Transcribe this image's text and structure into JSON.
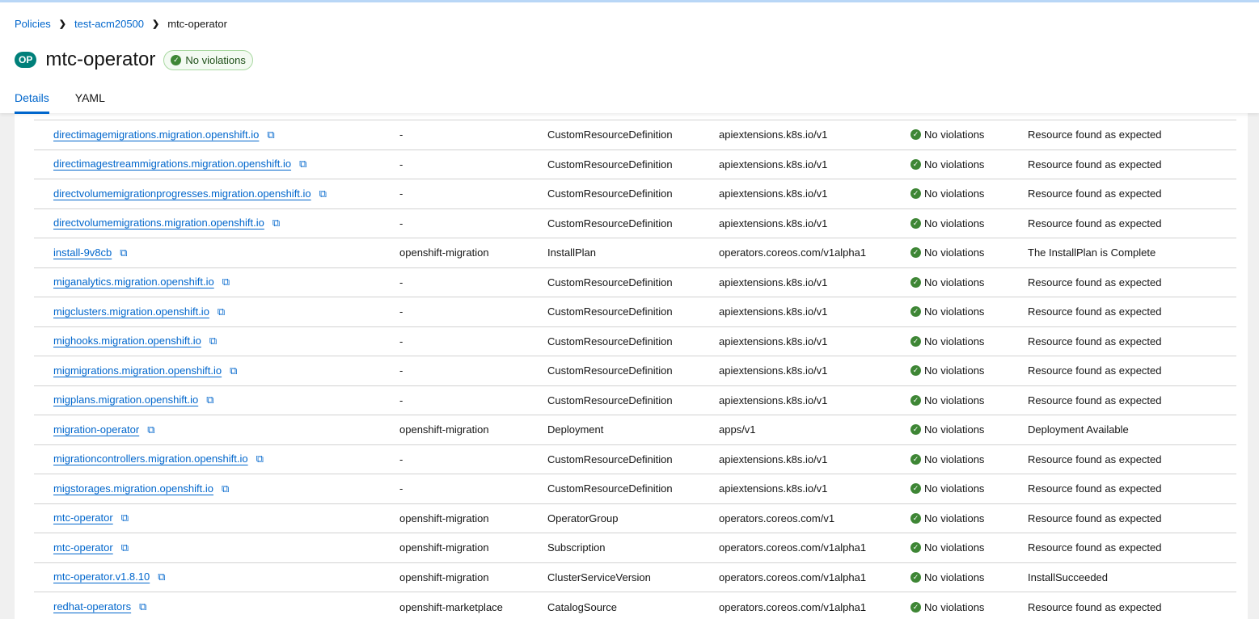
{
  "breadcrumb": {
    "items": [
      "Policies",
      "test-acm20500"
    ],
    "current": "mtc-operator"
  },
  "header": {
    "badge": "OP",
    "title": "mtc-operator",
    "status": "No violations"
  },
  "tabs": [
    "Details",
    "YAML"
  ],
  "rows": [
    {
      "name": "directimagemigrations.migration.openshift.io",
      "namespace": "-",
      "kind": "CustomResourceDefinition",
      "api": "apiextensions.k8s.io/v1",
      "status": "No violations",
      "message": "Resource found as expected"
    },
    {
      "name": "directimagestreammigrations.migration.openshift.io",
      "namespace": "-",
      "kind": "CustomResourceDefinition",
      "api": "apiextensions.k8s.io/v1",
      "status": "No violations",
      "message": "Resource found as expected"
    },
    {
      "name": "directvolumemigrationprogresses.migration.openshift.io",
      "namespace": "-",
      "kind": "CustomResourceDefinition",
      "api": "apiextensions.k8s.io/v1",
      "status": "No violations",
      "message": "Resource found as expected"
    },
    {
      "name": "directvolumemigrations.migration.openshift.io",
      "namespace": "-",
      "kind": "CustomResourceDefinition",
      "api": "apiextensions.k8s.io/v1",
      "status": "No violations",
      "message": "Resource found as expected"
    },
    {
      "name": "install-9v8cb",
      "namespace": "openshift-migration",
      "kind": "InstallPlan",
      "api": "operators.coreos.com/v1alpha1",
      "status": "No violations",
      "message": "The InstallPlan is Complete"
    },
    {
      "name": "miganalytics.migration.openshift.io",
      "namespace": "-",
      "kind": "CustomResourceDefinition",
      "api": "apiextensions.k8s.io/v1",
      "status": "No violations",
      "message": "Resource found as expected"
    },
    {
      "name": "migclusters.migration.openshift.io",
      "namespace": "-",
      "kind": "CustomResourceDefinition",
      "api": "apiextensions.k8s.io/v1",
      "status": "No violations",
      "message": "Resource found as expected"
    },
    {
      "name": "mighooks.migration.openshift.io",
      "namespace": "-",
      "kind": "CustomResourceDefinition",
      "api": "apiextensions.k8s.io/v1",
      "status": "No violations",
      "message": "Resource found as expected"
    },
    {
      "name": "migmigrations.migration.openshift.io",
      "namespace": "-",
      "kind": "CustomResourceDefinition",
      "api": "apiextensions.k8s.io/v1",
      "status": "No violations",
      "message": "Resource found as expected"
    },
    {
      "name": "migplans.migration.openshift.io",
      "namespace": "-",
      "kind": "CustomResourceDefinition",
      "api": "apiextensions.k8s.io/v1",
      "status": "No violations",
      "message": "Resource found as expected"
    },
    {
      "name": "migration-operator",
      "namespace": "openshift-migration",
      "kind": "Deployment",
      "api": "apps/v1",
      "status": "No violations",
      "message": "Deployment Available"
    },
    {
      "name": "migrationcontrollers.migration.openshift.io",
      "namespace": "-",
      "kind": "CustomResourceDefinition",
      "api": "apiextensions.k8s.io/v1",
      "status": "No violations",
      "message": "Resource found as expected"
    },
    {
      "name": "migstorages.migration.openshift.io",
      "namespace": "-",
      "kind": "CustomResourceDefinition",
      "api": "apiextensions.k8s.io/v1",
      "status": "No violations",
      "message": "Resource found as expected"
    },
    {
      "name": "mtc-operator",
      "namespace": "openshift-migration",
      "kind": "OperatorGroup",
      "api": "operators.coreos.com/v1",
      "status": "No violations",
      "message": "Resource found as expected"
    },
    {
      "name": "mtc-operator",
      "namespace": "openshift-migration",
      "kind": "Subscription",
      "api": "operators.coreos.com/v1alpha1",
      "status": "No violations",
      "message": "Resource found as expected"
    },
    {
      "name": "mtc-operator.v1.8.10",
      "namespace": "openshift-migration",
      "kind": "ClusterServiceVersion",
      "api": "operators.coreos.com/v1alpha1",
      "status": "No violations",
      "message": "InstallSucceeded"
    },
    {
      "name": "redhat-operators",
      "namespace": "openshift-marketplace",
      "kind": "CatalogSource",
      "api": "operators.coreos.com/v1alpha1",
      "status": "No violations",
      "message": "Resource found as expected"
    }
  ]
}
